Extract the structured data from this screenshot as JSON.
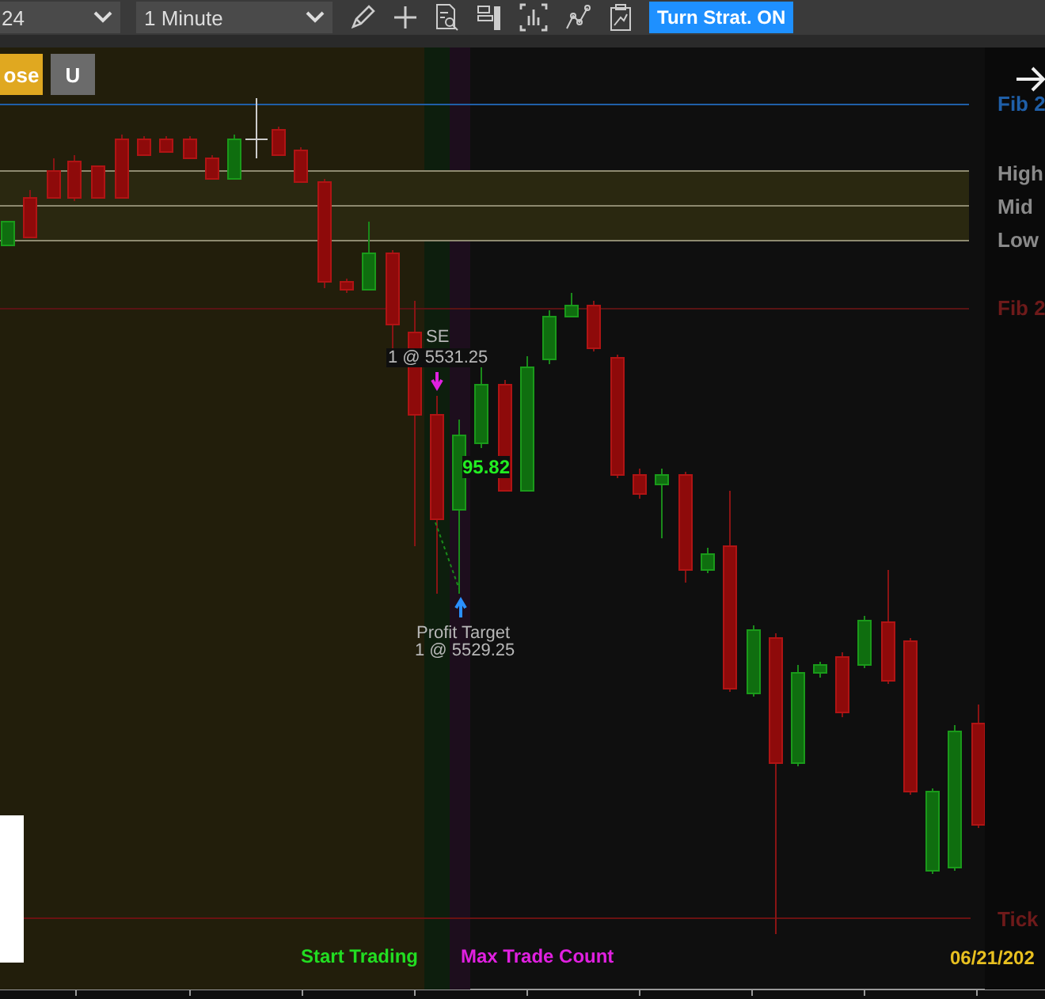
{
  "toolbar": {
    "symbol_dropdown": "24",
    "interval_dropdown": "1 Minute",
    "strategy_button": "Turn Strat. ON"
  },
  "chart": {
    "buttons": [
      {
        "label": "ose",
        "color": "#e0a820"
      },
      {
        "label": "U",
        "color": "#6b6b6b"
      }
    ],
    "level_labels": [
      {
        "text": "Fib 2",
        "color": "#1f5fa8"
      },
      {
        "text": "High",
        "color": "#8a8a8a"
      },
      {
        "text": "Mid",
        "color": "#8a8a8a"
      },
      {
        "text": "Low",
        "color": "#8a8a8a"
      },
      {
        "text": "Fib 2",
        "color": "#6e1a1a"
      },
      {
        "text": "Tick",
        "color": "#6e1a1a"
      }
    ],
    "entry": {
      "signal": "SE",
      "fill": "1 @ 5531.25"
    },
    "indicator_value": "95.82",
    "exit": {
      "signal": "Profit Target",
      "fill": "1 @ 5529.25"
    },
    "status_texts": [
      {
        "text": "Start Trading",
        "color": "#22dd22"
      },
      {
        "text": "Max Trade Count",
        "color": "#e020e0"
      }
    ],
    "date": "06/21/202"
  }
}
